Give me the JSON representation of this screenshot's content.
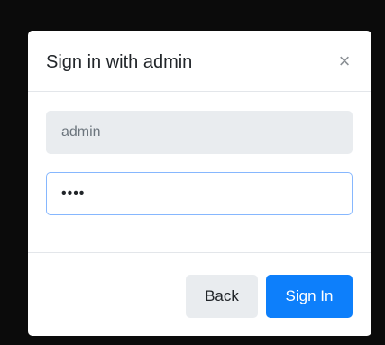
{
  "dialog": {
    "title": "Sign in with admin",
    "close_symbol": "×"
  },
  "form": {
    "username_value": "admin",
    "password_value": "••••"
  },
  "footer": {
    "back_label": "Back",
    "signin_label": "Sign In"
  },
  "colors": {
    "primary": "#0d7ffb",
    "secondary": "#e9ecef",
    "focus_border": "#86b7fe"
  }
}
